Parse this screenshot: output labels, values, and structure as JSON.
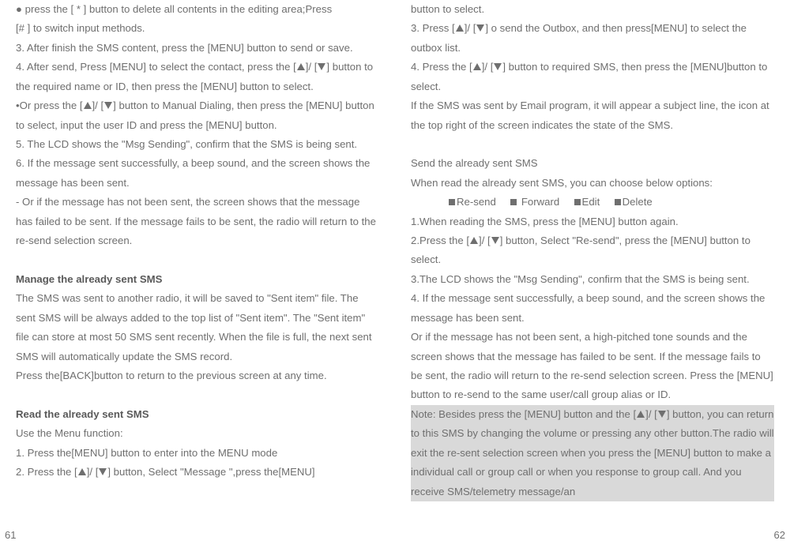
{
  "left": {
    "p1a": "● press the [  *  ] button to delete all contents in the editing area;Press",
    "p1b": "[# ] to switch input methods.",
    "p2": "3. After finish the SMS content, press the [MENU] button to send or save.",
    "p3a": "4. After send, Press [MENU] to select the contact, press the [",
    "p3b": "]/ [",
    "p3c": "] button to the required name or ID, then press the [MENU] button to select.",
    "p4a": "•Or press the [",
    "p4b": "]/ [",
    "p4c": "] button to Manual Dialing, then press the [MENU] button to select, input the user ID and press the [MENU] button.",
    "p5": "5. The LCD shows the \"Msg  Sending\", confirm that the SMS is being sent.",
    "p6": "6. If the message sent successfully, a beep sound, and the screen shows the message has been sent.",
    "p7": "- Or if the message has not been sent, the screen shows that the message has failed to be sent. If the message fails to be sent, the radio will return to the re-send selection screen.",
    "h1": "Manage the already sent SMS",
    "p8": "The SMS was sent to another radio, it will be saved to \"Sent item\" file. The sent SMS will be always added to the top list of \"Sent item\". The \"Sent item\" file can store at most 50 SMS sent recently. When the file is full, the next sent SMS will automatically update the SMS record.",
    "p9": "Press the[BACK]button to return to the previous screen at any time.",
    "h2": "Read the already sent SMS",
    "p10": "Use the Menu function:",
    "p11": "1. Press the[MENU] button to enter into the MENU mode",
    "p12a": "2. Press the [",
    "p12b": "]/ [",
    "p12c": "] button, Select \"Message \",press the[MENU]",
    "pagenum": "61"
  },
  "right": {
    "p1": "button to select.",
    "p2a": "3.  Press [",
    "p2b": "]/ [",
    "p2c": "] o send the Outbox, and then press[MENU] to select the outbox list.",
    "p3a": "4.  Press the [",
    "p3b": "]/ [",
    "p3c": "] button to required SMS, then press the [MENU]button to select.",
    "p4": "If the SMS was sent by Email program, it will appear a subject line, the icon at the top right of the screen indicates the state of the SMS.",
    "p5": "Send the already sent SMS",
    "p6": "When read the already sent SMS, you can choose below options:",
    "opt1": "Re-send",
    "opt2": " Forward",
    "opt3": "Edit",
    "opt4": "Delete",
    "p7": "1.When reading the SMS, press the [MENU] button again.",
    "p8a": "2.Press the [",
    "p8b": "]/ [",
    "p8c": "] button, Select \"Re-send\", press the [MENU] button to select.",
    "p9": "3.The LCD shows the \"Msg  Sending\", confirm that the SMS is being sent.",
    "p10": "4. If the message sent successfully, a beep sound, and the screen shows the message has been sent.",
    "p11": "Or if the message has not been sent, a high-pitched tone sounds and the screen shows that the message has failed to be sent. If the message fails to be sent, the radio will return to the re-send selection screen. Press the [MENU] button to re-send to the same user/call group alias or ID.",
    "note_a": "Note: Besides press the [MENU] button and the [",
    "note_b": "]/ [",
    "note_c": "] button, you can return to this SMS by changing the volume or pressing any other button.The radio will exit the re-sent selection screen when you press the [MENU]  button to make a individual call or group call or when you response to group call. And you receive SMS/telemetry message/an",
    "pagenum": "62"
  }
}
